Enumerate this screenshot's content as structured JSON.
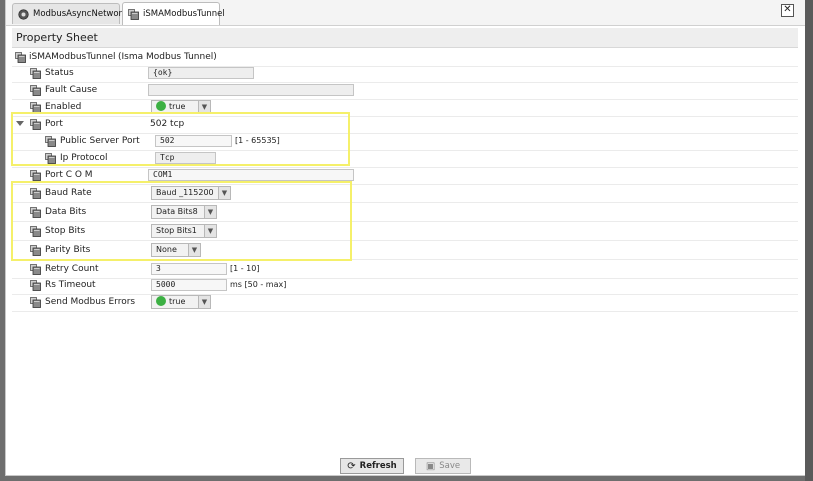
{
  "tabs": [
    {
      "label": "ModbusAsyncNetwork"
    },
    {
      "label": "iSMAModbusTunnel"
    }
  ],
  "close_symbol": "✕",
  "property_sheet_title": "Property Sheet",
  "component": {
    "name": "iSMAModbusTunnel",
    "type": "(Isma Modbus Tunnel)"
  },
  "properties": {
    "status": {
      "label": "Status",
      "value": "{ok}"
    },
    "fault_cause": {
      "label": "Fault Cause",
      "value": ""
    },
    "enabled": {
      "label": "Enabled",
      "value": "true"
    },
    "port": {
      "label": "Port",
      "value": "502 tcp"
    },
    "public_server_port": {
      "label": "Public Server Port",
      "value": "502",
      "range": "[1 - 65535]"
    },
    "ip_protocol": {
      "label": "Ip Protocol",
      "value": "Tcp"
    },
    "port_com": {
      "label": "Port C O M",
      "value": "COM1"
    },
    "baud_rate": {
      "label": "Baud Rate",
      "value": "Baud _115200"
    },
    "data_bits": {
      "label": "Data Bits",
      "value": "Data Bits8"
    },
    "stop_bits": {
      "label": "Stop Bits",
      "value": "Stop Bits1"
    },
    "parity_bits": {
      "label": "Parity Bits",
      "value": "None"
    },
    "retry_count": {
      "label": "Retry Count",
      "value": "3",
      "range": "[1 - 10]"
    },
    "rs_timeout": {
      "label": "Rs Timeout",
      "value": "5000",
      "range": "ms [50 - max]"
    },
    "send_modbus_errors": {
      "label": "Send Modbus Errors",
      "value": "true"
    }
  },
  "buttons": {
    "refresh": "Refresh",
    "save": "Save"
  },
  "colors": {
    "highlight": "#f5f06a",
    "enabled_dot": "#3cb043"
  },
  "icons": {
    "property": "slot-cube-icon",
    "component": "component-cube-icon"
  }
}
